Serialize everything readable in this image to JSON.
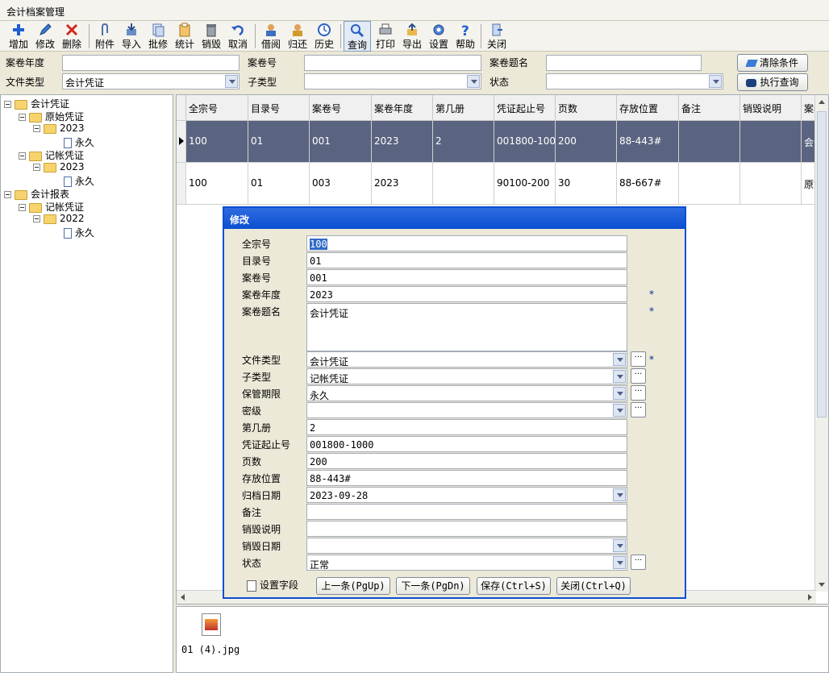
{
  "window": {
    "title": "会计档案管理"
  },
  "toolbar": [
    {
      "label": "增加",
      "icon": "add-icon"
    },
    {
      "label": "修改",
      "icon": "edit-icon"
    },
    {
      "label": "删除",
      "icon": "delete-icon"
    },
    {
      "label": "附件",
      "icon": "attachment-icon"
    },
    {
      "label": "导入",
      "icon": "import-icon"
    },
    {
      "label": "批修",
      "icon": "batch-edit-icon"
    },
    {
      "label": "统计",
      "icon": "statistics-icon"
    },
    {
      "label": "销毁",
      "icon": "destroy-icon"
    },
    {
      "label": "取消",
      "icon": "undo-icon"
    },
    {
      "label": "借阅",
      "icon": "borrow-icon"
    },
    {
      "label": "归还",
      "icon": "return-icon"
    },
    {
      "label": "历史",
      "icon": "history-icon"
    },
    {
      "label": "查询",
      "icon": "search-icon"
    },
    {
      "label": "打印",
      "icon": "print-icon"
    },
    {
      "label": "导出",
      "icon": "export-icon"
    },
    {
      "label": "设置",
      "icon": "settings-icon"
    },
    {
      "label": "帮助",
      "icon": "help-icon"
    },
    {
      "label": "关闭",
      "icon": "close-icon"
    }
  ],
  "filter": {
    "year_label": "案卷年度",
    "year_value": "",
    "volno_label": "案卷号",
    "volno_value": "",
    "voltitle_label": "案卷题名",
    "voltitle_value": "",
    "doctype_label": "文件类型",
    "doctype_value": "会计凭证",
    "subtype_label": "子类型",
    "subtype_value": "",
    "status_label": "状态",
    "status_value": "",
    "clear_btn": "清除条件",
    "query_btn": "执行查询"
  },
  "tree": [
    {
      "label": "会计凭证",
      "level": 0,
      "kind": "folder"
    },
    {
      "label": "原始凭证",
      "level": 1,
      "kind": "folder"
    },
    {
      "label": "2023",
      "level": 2,
      "kind": "folder"
    },
    {
      "label": "永久",
      "level": 3,
      "kind": "file"
    },
    {
      "label": "记帐凭证",
      "level": 1,
      "kind": "folder"
    },
    {
      "label": "2023",
      "level": 2,
      "kind": "folder"
    },
    {
      "label": "永久",
      "level": 3,
      "kind": "file"
    },
    {
      "label": "会计报表",
      "level": 0,
      "kind": "folder"
    },
    {
      "label": "记帐凭证",
      "level": 1,
      "kind": "folder"
    },
    {
      "label": "2022",
      "level": 2,
      "kind": "folder"
    },
    {
      "label": "永久",
      "level": 3,
      "kind": "file"
    }
  ],
  "grid": {
    "columns": [
      "全宗号",
      "目录号",
      "案卷号",
      "案卷年度",
      "第几册",
      "凭证起止号",
      "页数",
      "存放位置",
      "备注",
      "销毁说明",
      "案卷"
    ],
    "rows": [
      [
        "100",
        "01",
        "001",
        "2023",
        "2",
        "001800-100",
        "200",
        "88-443#",
        "",
        "",
        "会计"
      ],
      [
        "100",
        "01",
        "003",
        "2023",
        "",
        "90100-200",
        "30",
        "88-667#",
        "",
        "",
        "原始"
      ]
    ]
  },
  "attachment": {
    "filename": "01 (4).jpg"
  },
  "dialog": {
    "title": "修改",
    "fields": [
      {
        "label": "全宗号",
        "value": "100"
      },
      {
        "label": "目录号",
        "value": "01"
      },
      {
        "label": "案卷号",
        "value": "001"
      },
      {
        "label": "案卷年度",
        "value": "2023",
        "required": "*"
      },
      {
        "label": "案卷题名",
        "value": "会计凭证",
        "required": "*"
      },
      {
        "label": "文件类型",
        "value": "会计凭证",
        "required": "*"
      },
      {
        "label": "子类型",
        "value": "记帐凭证"
      },
      {
        "label": "保管期限",
        "value": "永久"
      },
      {
        "label": "密级",
        "value": ""
      },
      {
        "label": "第几册",
        "value": "2"
      },
      {
        "label": "凭证起止号",
        "value": "001800-1000"
      },
      {
        "label": "页数",
        "value": "200"
      },
      {
        "label": "存放位置",
        "value": "88-443#"
      },
      {
        "label": "归档日期",
        "value": "2023-09-28"
      },
      {
        "label": "备注",
        "value": ""
      },
      {
        "label": "销毁说明",
        "value": ""
      },
      {
        "label": "销毁日期",
        "value": ""
      },
      {
        "label": "状态",
        "value": "正常"
      }
    ],
    "ellipsis": "···",
    "set_fields": "设置字段",
    "prev_btn": "上一条(PgUp)",
    "next_btn": "下一条(PgDn)",
    "save_btn": "保存(Ctrl+S)",
    "close_btn": "关闭(Ctrl+Q)"
  }
}
